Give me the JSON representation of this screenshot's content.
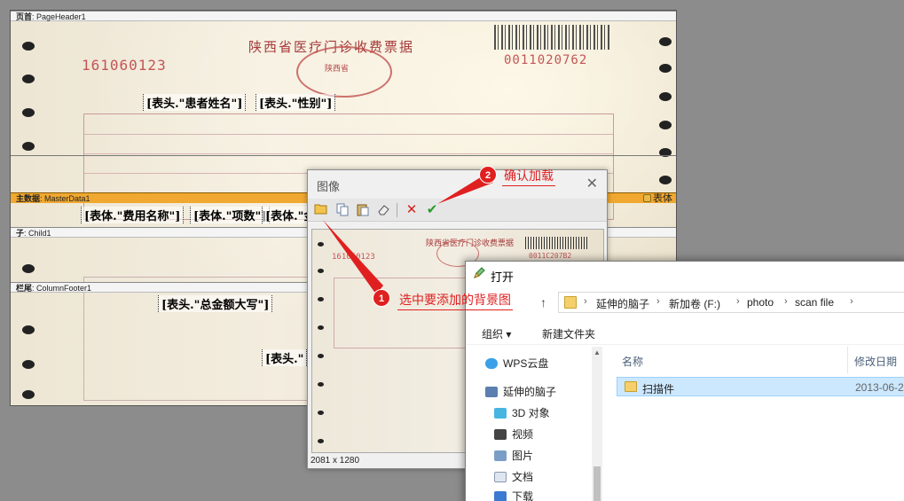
{
  "report": {
    "bands": {
      "page_header": {
        "tag": "页首",
        "name": "PageHeader1"
      },
      "master_data": {
        "tag": "主数据",
        "name": "MasterData1"
      },
      "child": {
        "tag": "子",
        "name": "Child1"
      },
      "column_footer": {
        "tag": "栏尾",
        "name": "ColumnFooter1"
      }
    },
    "table_tag": "表体",
    "fields": {
      "patient_name": "[表头.\"患者姓名\"]",
      "gender": "[表头.\"性别\"]",
      "fee_name": "[表体.\"费用名称\"]",
      "item_count": "[表体.\"项数\"]",
      "amount_partial": "[表体.\"金",
      "total_caps": "[表头.\"总金额大写\"]",
      "partial_header": "[表头.\""
    },
    "background_image": {
      "title": "陕西省医疗门诊收费票据",
      "seal": "陕西省",
      "serial_left": "161060123",
      "serial_right": "0011020762"
    }
  },
  "image_dialog": {
    "title": "图像",
    "close": "✕",
    "preview": {
      "title": "陕西省医疗门诊收费票据",
      "serial_left": "161060123",
      "serial_right": "0011C207B2"
    },
    "status": "2081 x 1280"
  },
  "open_dialog": {
    "title": "打开",
    "breadcrumbs": [
      "延伸的脑子",
      "新加卷 (F:)",
      "photo",
      "scan file"
    ],
    "commands": {
      "organize": "组织 ▾",
      "new_folder": "新建文件夹"
    },
    "nav_items": [
      "WPS云盘",
      "延伸的脑子",
      "3D 对象",
      "视频",
      "图片",
      "文档",
      "下载"
    ],
    "columns": {
      "name": "名称",
      "modified": "修改日期"
    },
    "files": [
      {
        "name": "扫描件",
        "modified": "2013-06-2"
      }
    ]
  },
  "annotations": [
    {
      "number": "1",
      "text": "选中要添加的背景图"
    },
    {
      "number": "2",
      "text": "确认加载"
    }
  ],
  "colors": {
    "annotation_red": "#e02020",
    "master_band": "#f0a830",
    "selected_row": "#cce8ff"
  }
}
